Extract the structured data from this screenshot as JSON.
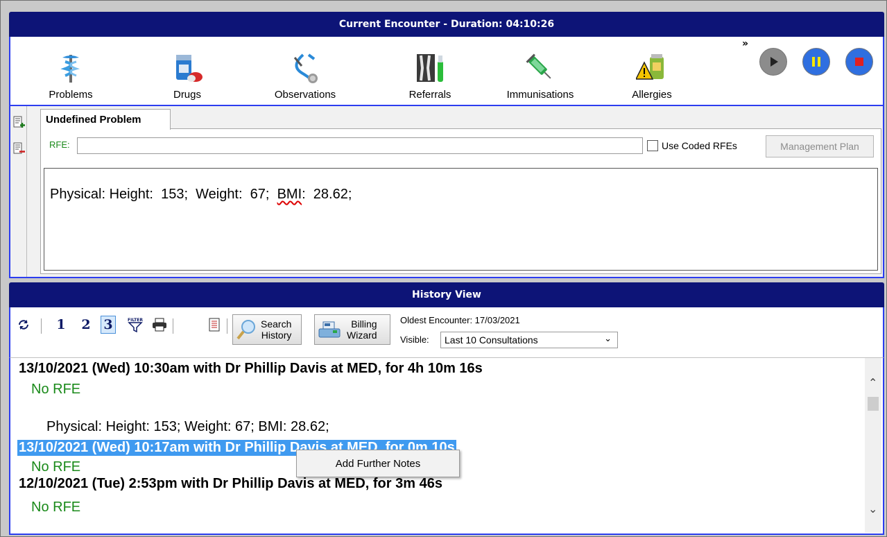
{
  "encounter": {
    "title": "Current Encounter - Duration: 04:10:26"
  },
  "toolbar": {
    "items": [
      {
        "label": "Problems",
        "icon": "caduceus-icon"
      },
      {
        "label": "Drugs",
        "icon": "medicine-bottle-icon"
      },
      {
        "label": "Observations",
        "icon": "stethoscope-icon"
      },
      {
        "label": "Referrals",
        "icon": "xray-referral-icon"
      },
      {
        "label": "Immunisations",
        "icon": "syringe-icon"
      },
      {
        "label": "Allergies",
        "icon": "allergy-warning-icon"
      }
    ],
    "more": "»",
    "media": {
      "play": "play-icon",
      "pause": "pause-icon",
      "stop": "stop-icon"
    }
  },
  "problem": {
    "tab_label": "Undefined Problem",
    "rfe_label": "RFE:",
    "rfe_value": "",
    "use_coded_label": "Use Coded RFEs",
    "use_coded_checked": false,
    "management_plan_label": "Management Plan",
    "note_prefix": "Physical: Height:  153;  Weight:  67;  ",
    "note_bmi_word": "BMI",
    "note_suffix": ":  28.62;"
  },
  "history": {
    "title": "History View",
    "page_buttons": [
      "1",
      "2",
      "3"
    ],
    "active_page": "3",
    "search_label_1": "Search",
    "search_label_2": "History",
    "billing_label_1": "Billing",
    "billing_label_2": "Wizard",
    "oldest_label": "Oldest Encounter: 17/03/2021",
    "visible_label": "Visible:",
    "visible_value": "Last 10 Consultations",
    "entries": [
      {
        "header": "13/10/2021 (Wed) 10:30am with Dr Phillip Davis at MED, for 4h 10m 16s",
        "rfe": "No RFE",
        "body": "Physical: Height:  153;  Weight:  67;  BMI:  28.62;"
      },
      {
        "header": "13/10/2021 (Wed) 10:17am with Dr Phillip Davis at MED, for 0m 10s",
        "rfe": "No RFE"
      },
      {
        "header": "12/10/2021 (Tue) 2:53pm with Dr Phillip Davis at MED, for 3m 46s",
        "rfe": "No RFE"
      }
    ],
    "context_menu": {
      "item": "Add Further Notes"
    }
  },
  "colors": {
    "title_bar": "#0d1477",
    "panel_border": "#2c3df0",
    "rfe_green": "#1a8a1a",
    "selection": "#3f9af0"
  }
}
